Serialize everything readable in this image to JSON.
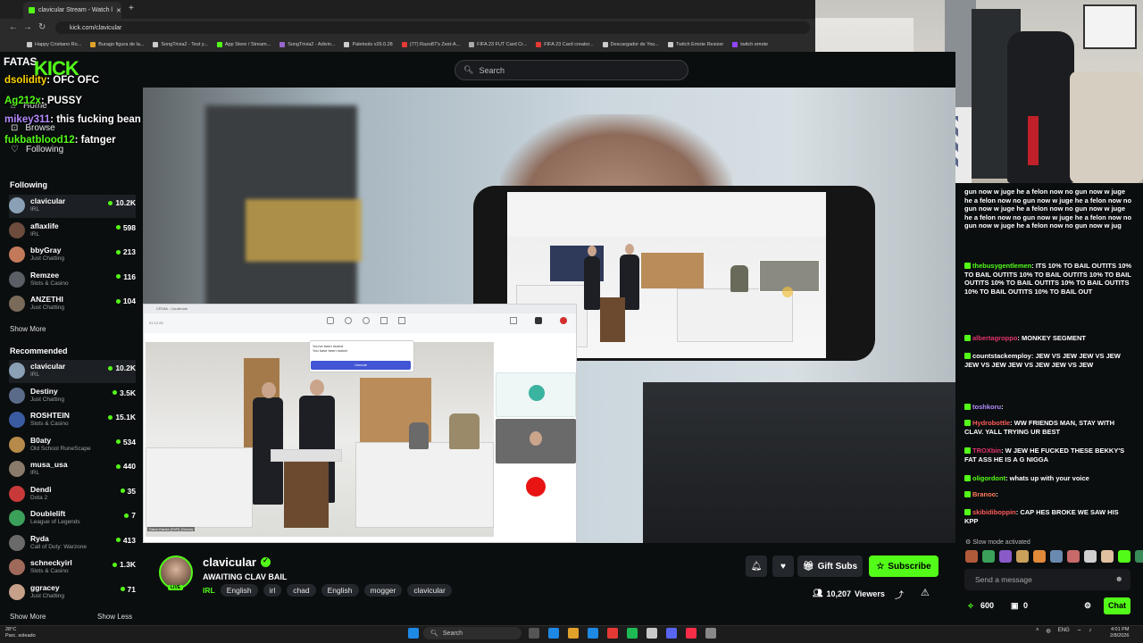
{
  "browser": {
    "tab_title": "clavicular Stream - Watch l",
    "url": "kick.com/clavicular",
    "bookmarks": [
      {
        "label": "Happy Cristiano Ro...",
        "color": "#c9c9c9"
      },
      {
        "label": "Burago figura de la...",
        "color": "#e0a12b"
      },
      {
        "label": "SongTrivia2 - Test y...",
        "color": "#cccccc"
      },
      {
        "label": "App Store / Stream...",
        "color": "#53fc18"
      },
      {
        "label": "SongTrivia2 - Adivin...",
        "color": "#9966cc"
      },
      {
        "label": "Paletools v26.0.28",
        "color": "#cccccc"
      },
      {
        "label": "(77) Razo87's Zest-A...",
        "color": "#e53935"
      },
      {
        "label": "FIFA 23 FUT Card Cr...",
        "color": "#aaaaaa"
      },
      {
        "label": "FIFA 23 Card creator...",
        "color": "#e53935"
      },
      {
        "label": "Descargador de You...",
        "color": "#cccccc"
      },
      {
        "label": "Twitch Emote Resizer",
        "color": "#cccccc"
      },
      {
        "label": "twitch emote",
        "color": "#9146ff"
      }
    ]
  },
  "header": {
    "search_placeholder": "Search",
    "logo": "KICK",
    "overlay_name": "FATAS"
  },
  "sidebar": {
    "nav": [
      "Home",
      "Browse",
      "Following"
    ],
    "following_title": "Following",
    "following": [
      {
        "name": "clavicular",
        "category": "IRL",
        "viewers": "10.2K",
        "color": "#8aa0b5"
      },
      {
        "name": "aflaxlife",
        "category": "IRL",
        "viewers": "598",
        "color": "#6d4c3d"
      },
      {
        "name": "bbyGray",
        "category": "Just Chatting",
        "viewers": "213",
        "color": "#c27a5a"
      },
      {
        "name": "Remzee",
        "category": "Slots & Casino",
        "viewers": "116",
        "color": "#5a5f66"
      },
      {
        "name": "ANZETHI",
        "category": "Just Chatting",
        "viewers": "104",
        "color": "#7a6a5a"
      }
    ],
    "show_more": "Show More",
    "recommended_title": "Recommended",
    "recommended": [
      {
        "name": "clavicular",
        "category": "IRL",
        "viewers": "10.2K",
        "color": "#8aa0b5"
      },
      {
        "name": "Destiny",
        "category": "Just Chatting",
        "viewers": "3.5K",
        "color": "#5a6b8a"
      },
      {
        "name": "ROSHTEIN",
        "category": "Slots & Casino",
        "viewers": "15.1K",
        "color": "#3a5ba0"
      },
      {
        "name": "B0aty",
        "category": "Old School RuneScape",
        "viewers": "534",
        "color": "#b58a4a"
      },
      {
        "name": "musa_usa",
        "category": "IRL",
        "viewers": "440",
        "color": "#8a7a6a"
      },
      {
        "name": "Dendi",
        "category": "Dota 2",
        "viewers": "35",
        "color": "#c83a3a"
      },
      {
        "name": "Doublelift",
        "category": "League of Legends",
        "viewers": "7",
        "color": "#3aa05a"
      },
      {
        "name": "Ryda",
        "category": "Call of Duty: Warzone",
        "viewers": "413",
        "color": "#6a6a6a"
      },
      {
        "name": "schneckyirl",
        "category": "Slots & Casino",
        "viewers": "1.3K",
        "color": "#a06a5a"
      },
      {
        "name": "ggracey",
        "category": "Just Chatting",
        "viewers": "71",
        "color": "#c7a08a"
      }
    ],
    "show_more_2": "Show More",
    "show_less": "Show Less"
  },
  "overlay_chat": [
    {
      "user": "dsolidity",
      "text": ": OFC OFC",
      "color": "#ffd600"
    },
    {
      "user": "Ag212x",
      "text": ": PUSSY",
      "color": "#53fc18"
    },
    {
      "user": "mikey311",
      "text": ": this fucking bean",
      "color": "#b48cff"
    },
    {
      "user": "fukbatblood12",
      "text": ": fatnger",
      "color": "#53fc18"
    }
  ],
  "zoom": {
    "title": "CR15A - Courtroom",
    "time": "01:12:28",
    "notice_title": "You've been muted",
    "notice_body": "You have been muted",
    "unmute_label": "Unmute",
    "bottom_label": "Dana Garcia (SVR) (Guest)"
  },
  "stream": {
    "streamer": "clavicular",
    "title": "AWAITING CLAV BAIL",
    "category": "IRL",
    "tags": [
      "English",
      "irl",
      "chad",
      "English",
      "mogger",
      "clavicular"
    ],
    "live": "LIVE",
    "gift_label": "Gift Subs",
    "subscribe_label": "Subscribe",
    "viewers": "10,207",
    "viewers_label": "Viewers"
  },
  "chat": {
    "messages": [
      {
        "user": "",
        "text": "gun now w juge he a felon now no gun now w juge he a felon now no gun now w juge he a felon now no gun now w juge he a felon now no gun now w juge he a felon now no gun now w juge he a felon now no gun now w juge he a felon now no gun now w jug",
        "color": "#53fc18"
      },
      {
        "user": "thebusygentlemen",
        "text": ": ITS 10% TO BAIL OUTITS 10% TO BAIL OUTITS 10% TO BAIL OUTITS 10% TO BAIL OUTITS 10% TO BAIL OUTITS 10% TO BAIL OUTITS 10% TO BAIL OUTITS 10% TO BAIL OUT",
        "color": "#53fc18"
      },
      {
        "user": "albertagroppo",
        "text": ": MONKEY SEGMENT",
        "color": "#e0346b"
      },
      {
        "user": "countstackemploy",
        "text": ": JEW VS JEW JEW VS JEW JEW VS JEW JEW VS JEW JEW VS JEW",
        "color": "#ffffff"
      },
      {
        "user": "toshkoru",
        "text": ":",
        "color": "#b48cff"
      },
      {
        "user": "Hydrobottle",
        "text": ": WW FRIENDS MAN, STAY WITH CLAV. YALL TRYING UR BEST",
        "color": "#ff5a5a"
      },
      {
        "user": "TROXbin",
        "text": ": W JEW HE FUCKED THESE BEKKY'S FAT ASS HE IS A G NIGGA",
        "color": "#e0346b"
      },
      {
        "user": "oligordont",
        "text": ": whats up with your voice",
        "color": "#53fc18"
      },
      {
        "user": "Branoo",
        "text": ":",
        "color": "#ff7a5a"
      },
      {
        "user": "skibidiboppin",
        "text": ": CAP HES BROKE WE SAW HIS KPP",
        "color": "#ff5a5a"
      }
    ],
    "slow_mode": "Slow mode activated",
    "input_placeholder": "Send a message",
    "points": "600",
    "redeem": "0",
    "chat_button": "Chat"
  },
  "taskbar": {
    "weather_temp": "28°C",
    "weather_desc": "Parc. soleado",
    "search": "Search",
    "lang": "ENG",
    "time": "4:01 PM",
    "date": "2/8/2026"
  }
}
